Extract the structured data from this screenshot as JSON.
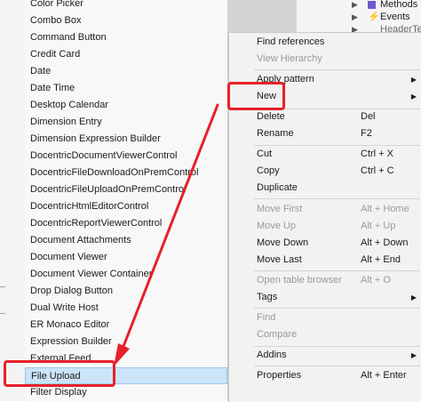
{
  "submenu": {
    "items": [
      "Color Picker",
      "Combo Box",
      "Command Button",
      "Credit Card",
      "Date",
      "Date Time",
      "Desktop Calendar",
      "Dimension Entry",
      "Dimension Expression Builder",
      "DocentricDocumentViewerControl",
      "DocentricFileDownloadOnPremControl",
      "DocentricFileUploadOnPremControl",
      "DocentricHtmlEditorControl",
      "DocentricReportViewerControl",
      "Document Attachments",
      "Document Viewer",
      "Document Viewer Container",
      "Drop Dialog Button",
      "Dual Write Host",
      "ER Monaco Editor",
      "Expression Builder",
      "External Feed",
      "File Upload",
      "Filter Display"
    ],
    "selected": "File Upload"
  },
  "tree": {
    "items": [
      {
        "label": "Methods",
        "icon": "methods-icon"
      },
      {
        "label": "Events",
        "icon": "lightning-icon"
      },
      {
        "label": "HeaderTe",
        "icon": "form-icon"
      }
    ]
  },
  "context_menu": {
    "items": [
      {
        "label": "Find references",
        "shortcut": "",
        "disabled": false,
        "submenu": false
      },
      {
        "label": "View Hierarchy",
        "shortcut": "",
        "disabled": true,
        "submenu": false
      },
      {
        "label": "Apply pattern",
        "shortcut": "",
        "disabled": false,
        "submenu": true
      },
      {
        "label": "New",
        "shortcut": "",
        "disabled": false,
        "submenu": true
      },
      {
        "label": "Delete",
        "shortcut": "Del",
        "disabled": false,
        "submenu": false
      },
      {
        "label": "Rename",
        "shortcut": "F2",
        "disabled": false,
        "submenu": false
      },
      {
        "label": "Cut",
        "shortcut": "Ctrl + X",
        "disabled": false,
        "submenu": false
      },
      {
        "label": "Copy",
        "shortcut": "Ctrl + C",
        "disabled": false,
        "submenu": false
      },
      {
        "label": "Duplicate",
        "shortcut": "",
        "disabled": false,
        "submenu": false
      },
      {
        "label": "Move First",
        "shortcut": "Alt + Home",
        "disabled": true,
        "submenu": false
      },
      {
        "label": "Move Up",
        "shortcut": "Alt + Up",
        "disabled": true,
        "submenu": false
      },
      {
        "label": "Move Down",
        "shortcut": "Alt + Down",
        "disabled": false,
        "submenu": false
      },
      {
        "label": "Move Last",
        "shortcut": "Alt + End",
        "disabled": false,
        "submenu": false
      },
      {
        "label": "Open table browser",
        "shortcut": "Alt + O",
        "disabled": true,
        "submenu": false
      },
      {
        "label": "Tags",
        "shortcut": "",
        "disabled": false,
        "submenu": true
      },
      {
        "label": "Find",
        "shortcut": "",
        "disabled": true,
        "submenu": false
      },
      {
        "label": "Compare",
        "shortcut": "",
        "disabled": true,
        "submenu": false
      },
      {
        "label": "Addins",
        "shortcut": "",
        "disabled": false,
        "submenu": true
      },
      {
        "label": "Properties",
        "shortcut": "Alt + Enter",
        "disabled": false,
        "submenu": false
      }
    ]
  },
  "annotation": {
    "color": "#e8202a"
  }
}
